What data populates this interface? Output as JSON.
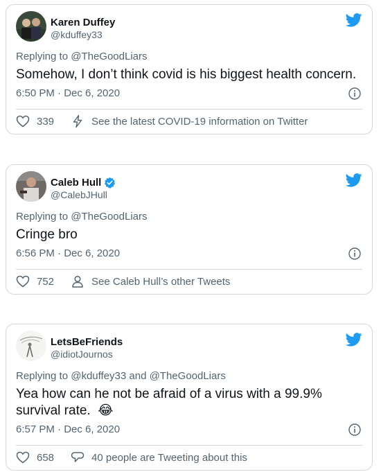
{
  "tweets": [
    {
      "name": "Karen Duffey",
      "handle": "@kduffey33",
      "verified": false,
      "replying": "Replying to @TheGoodLiars",
      "text": "Somehow, I don’t think covid is his biggest health concern.",
      "time": "6:50 PM · Dec 6, 2020",
      "likes": "339",
      "footer_icon": "lightning-icon",
      "footer_text": "See the latest COVID-19 information on Twitter"
    },
    {
      "name": "Caleb Hull",
      "handle": "@CalebJHull",
      "verified": true,
      "replying": "Replying to @TheGoodLiars",
      "text": "Cringe bro",
      "time": "6:56 PM · Dec 6, 2020",
      "likes": "752",
      "footer_icon": "person-icon",
      "footer_text": "See Caleb Hull’s other Tweets"
    },
    {
      "name": "LetsBeFriends",
      "handle": "@idiotJournos",
      "verified": false,
      "replying": "Replying to @kduffey33 and @TheGoodLiars",
      "text": "Yea how can he not be afraid of a virus with a 99.9% survival rate.",
      "emoji": "😂",
      "time": "6:57 PM · Dec 6, 2020",
      "likes": "658",
      "footer_icon": "speech-bubble-icon",
      "footer_text": "40 people are Tweeting about this"
    }
  ],
  "colors": {
    "twitter_blue": "#1d9bf0",
    "secondary_text": "#536471",
    "border": "#cfd9de"
  }
}
